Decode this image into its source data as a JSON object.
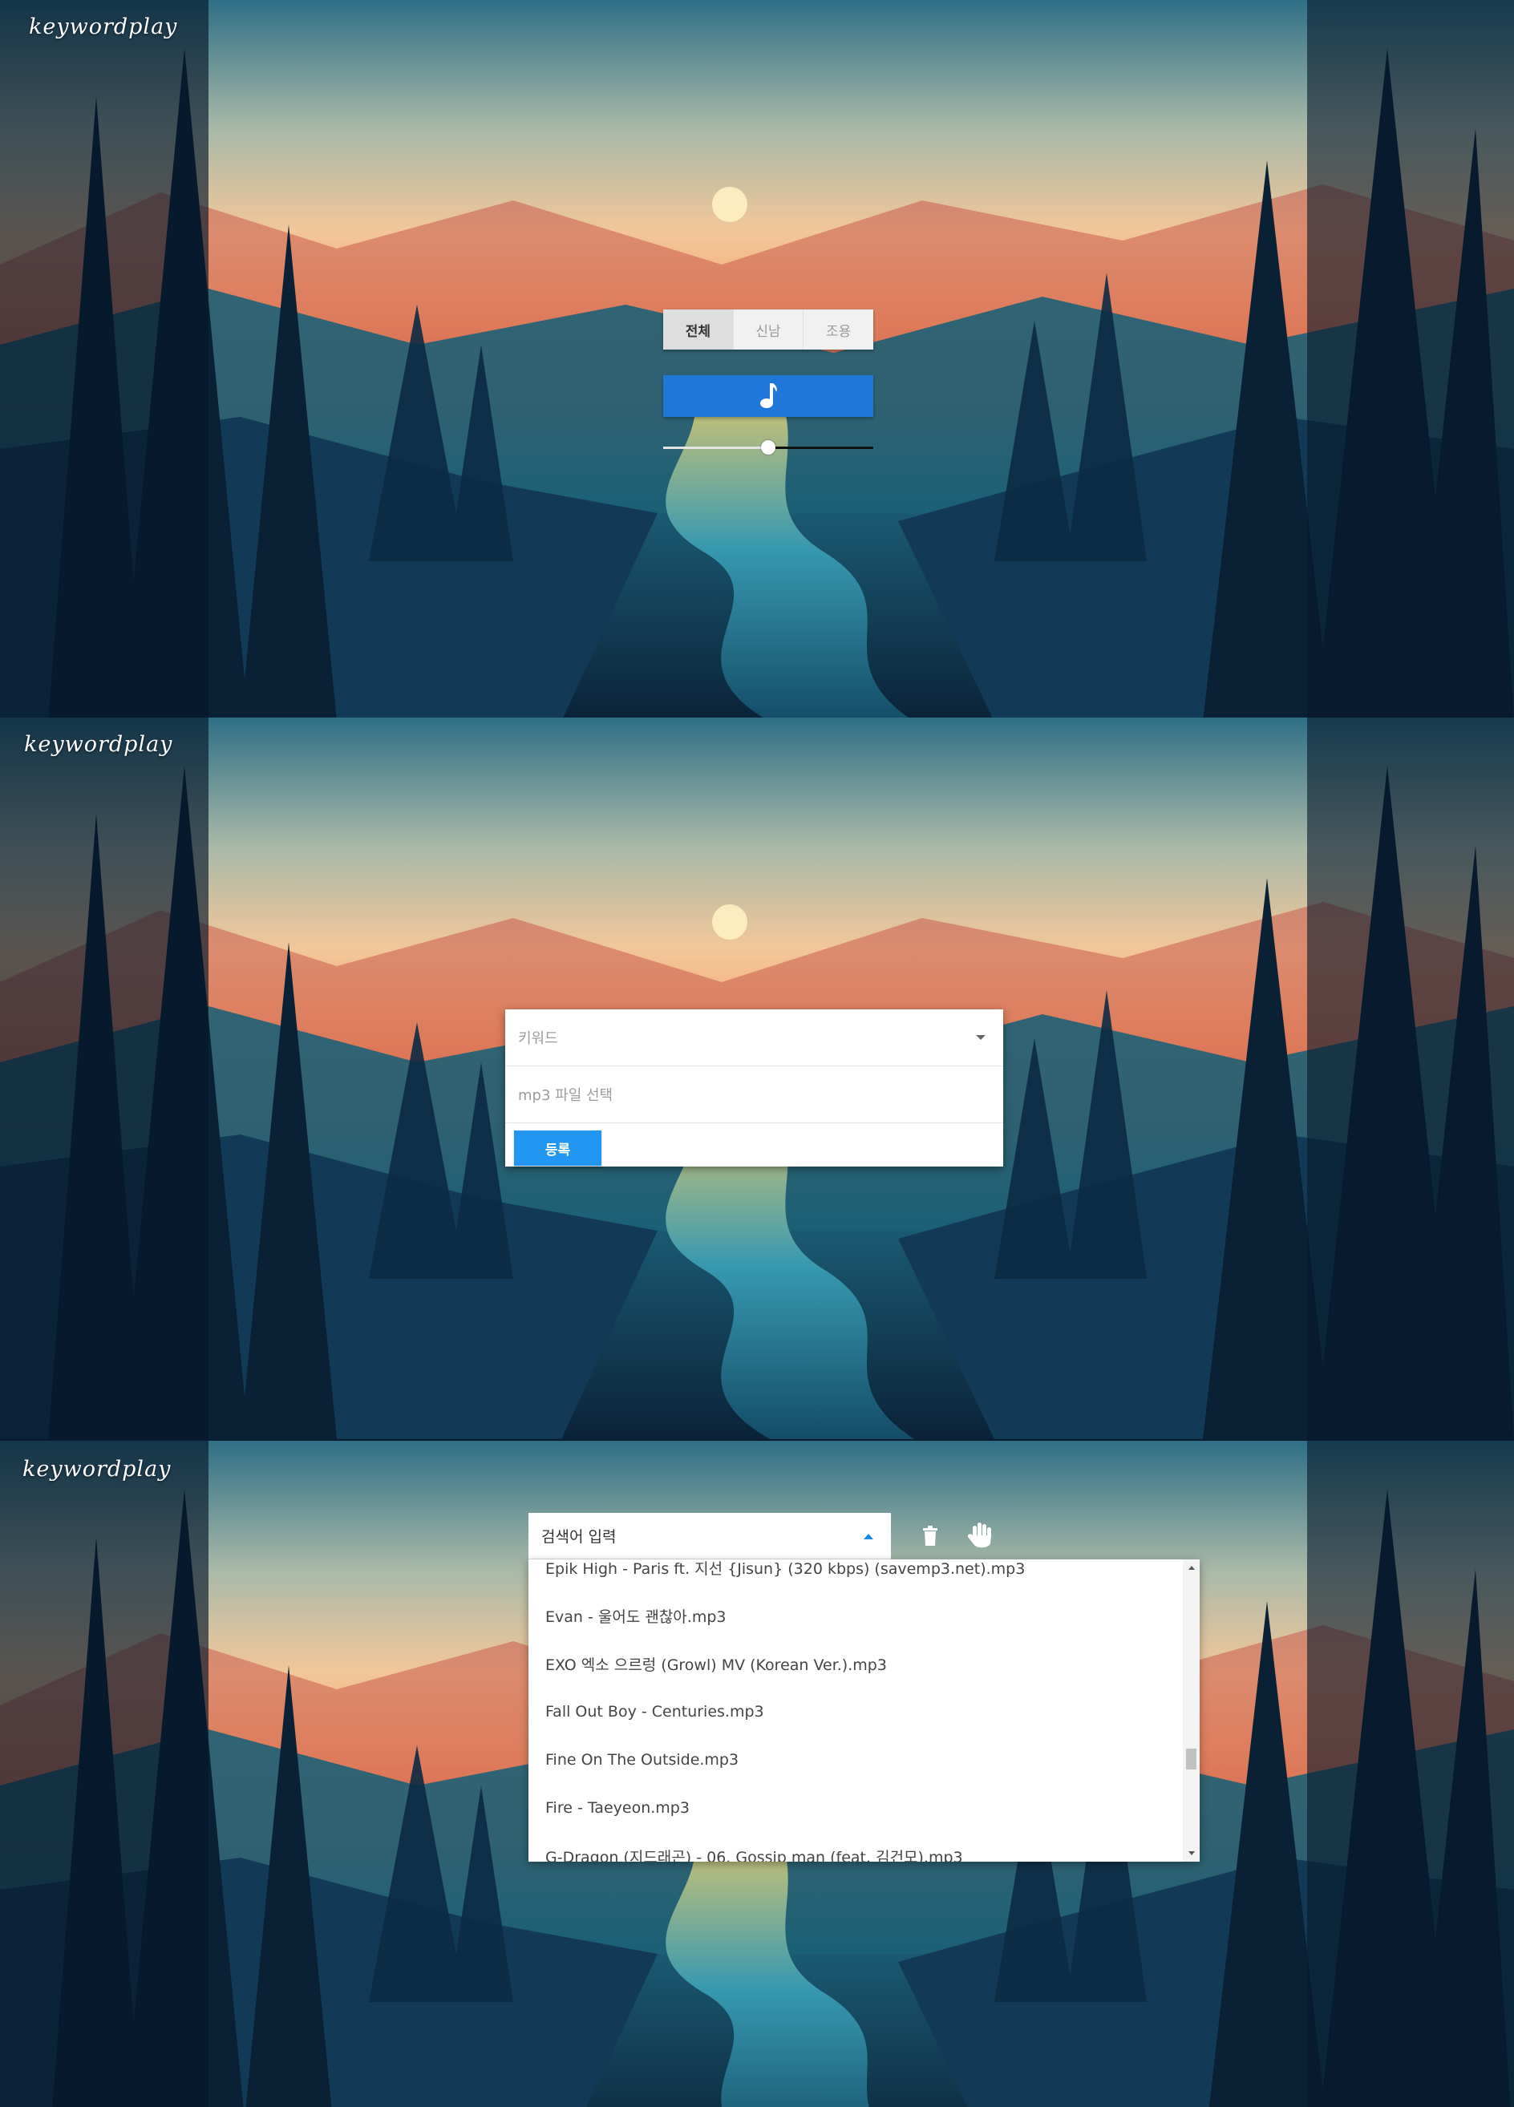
{
  "brand": {
    "logo": "keywordplay"
  },
  "player": {
    "tabs": [
      {
        "label": "전체",
        "active": true
      },
      {
        "label": "신남",
        "active": false
      },
      {
        "label": "조용",
        "active": false
      }
    ],
    "play_icon": "music-note-icon",
    "volume": 0.5
  },
  "upload": {
    "keyword_placeholder": "키워드",
    "file_placeholder": "mp3 파일 선택",
    "submit_label": "등록"
  },
  "search": {
    "placeholder": "검색어 입력",
    "delete_icon": "trash-icon",
    "grab_icon": "hand-icon",
    "results": [
      "Epik High - Paris ft. 지선 {Jisun} (320 kbps) (savemp3.net).mp3",
      "Evan - 울어도 괜찮아.mp3",
      "EXO 엑소 으르렁 (Growl) MV (Korean Ver.).mp3",
      "Fall Out Boy - Centuries.mp3",
      "Fine On The Outside.mp3",
      "Fire - Taeyeon.mp3",
      "G-Dragon (지드래곤) - 06. Gossip man (feat. 김건모).mp3"
    ]
  },
  "colors": {
    "accent": "#1f78d8",
    "submit": "#2196f3",
    "caret": "#1e88e5"
  }
}
